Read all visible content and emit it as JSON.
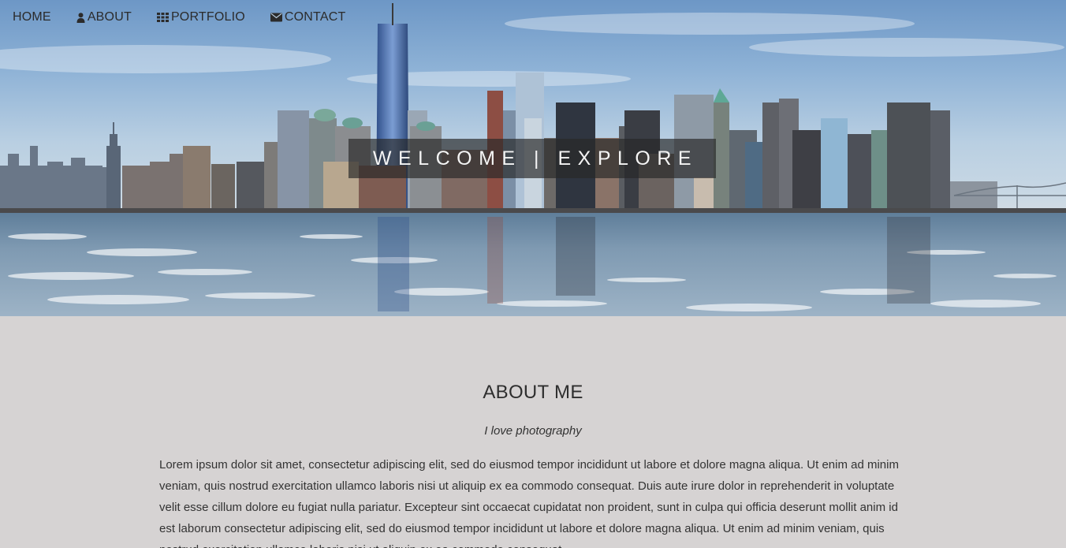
{
  "nav": {
    "items": [
      {
        "label": "HOME",
        "icon": ""
      },
      {
        "label": "ABOUT",
        "icon": "user-icon"
      },
      {
        "label": "PORTFOLIO",
        "icon": "grid-icon"
      },
      {
        "label": "CONTACT",
        "icon": "envelope-icon"
      }
    ]
  },
  "hero": {
    "banner_text": "WELCOME | EXPLORE",
    "image": "city-skyline-waterfront"
  },
  "about": {
    "title": "ABOUT ME",
    "subtitle": "I love photography",
    "body": "Lorem ipsum dolor sit amet, consectetur adipiscing elit, sed do eiusmod tempor incididunt ut labore et dolore magna aliqua. Ut enim ad minim veniam, quis nostrud exercitation ullamco laboris nisi ut aliquip ex ea commodo consequat. Duis aute irure dolor in reprehenderit in voluptate velit esse cillum dolore eu fugiat nulla pariatur. Excepteur sint occaecat cupidatat non proident, sunt in culpa qui officia deserunt mollit anim id est laborum consectetur adipiscing elit, sed do eiusmod tempor incididunt ut labore et dolore magna aliqua. Ut enim ad minim veniam, quis nostrud exercitation ullamco laboris nisi ut aliquip ex ea commodo consequat."
  },
  "colors": {
    "page_background": "#d6d3d3",
    "banner_background": "rgba(40,40,40,0.68)",
    "text": "#333333"
  }
}
